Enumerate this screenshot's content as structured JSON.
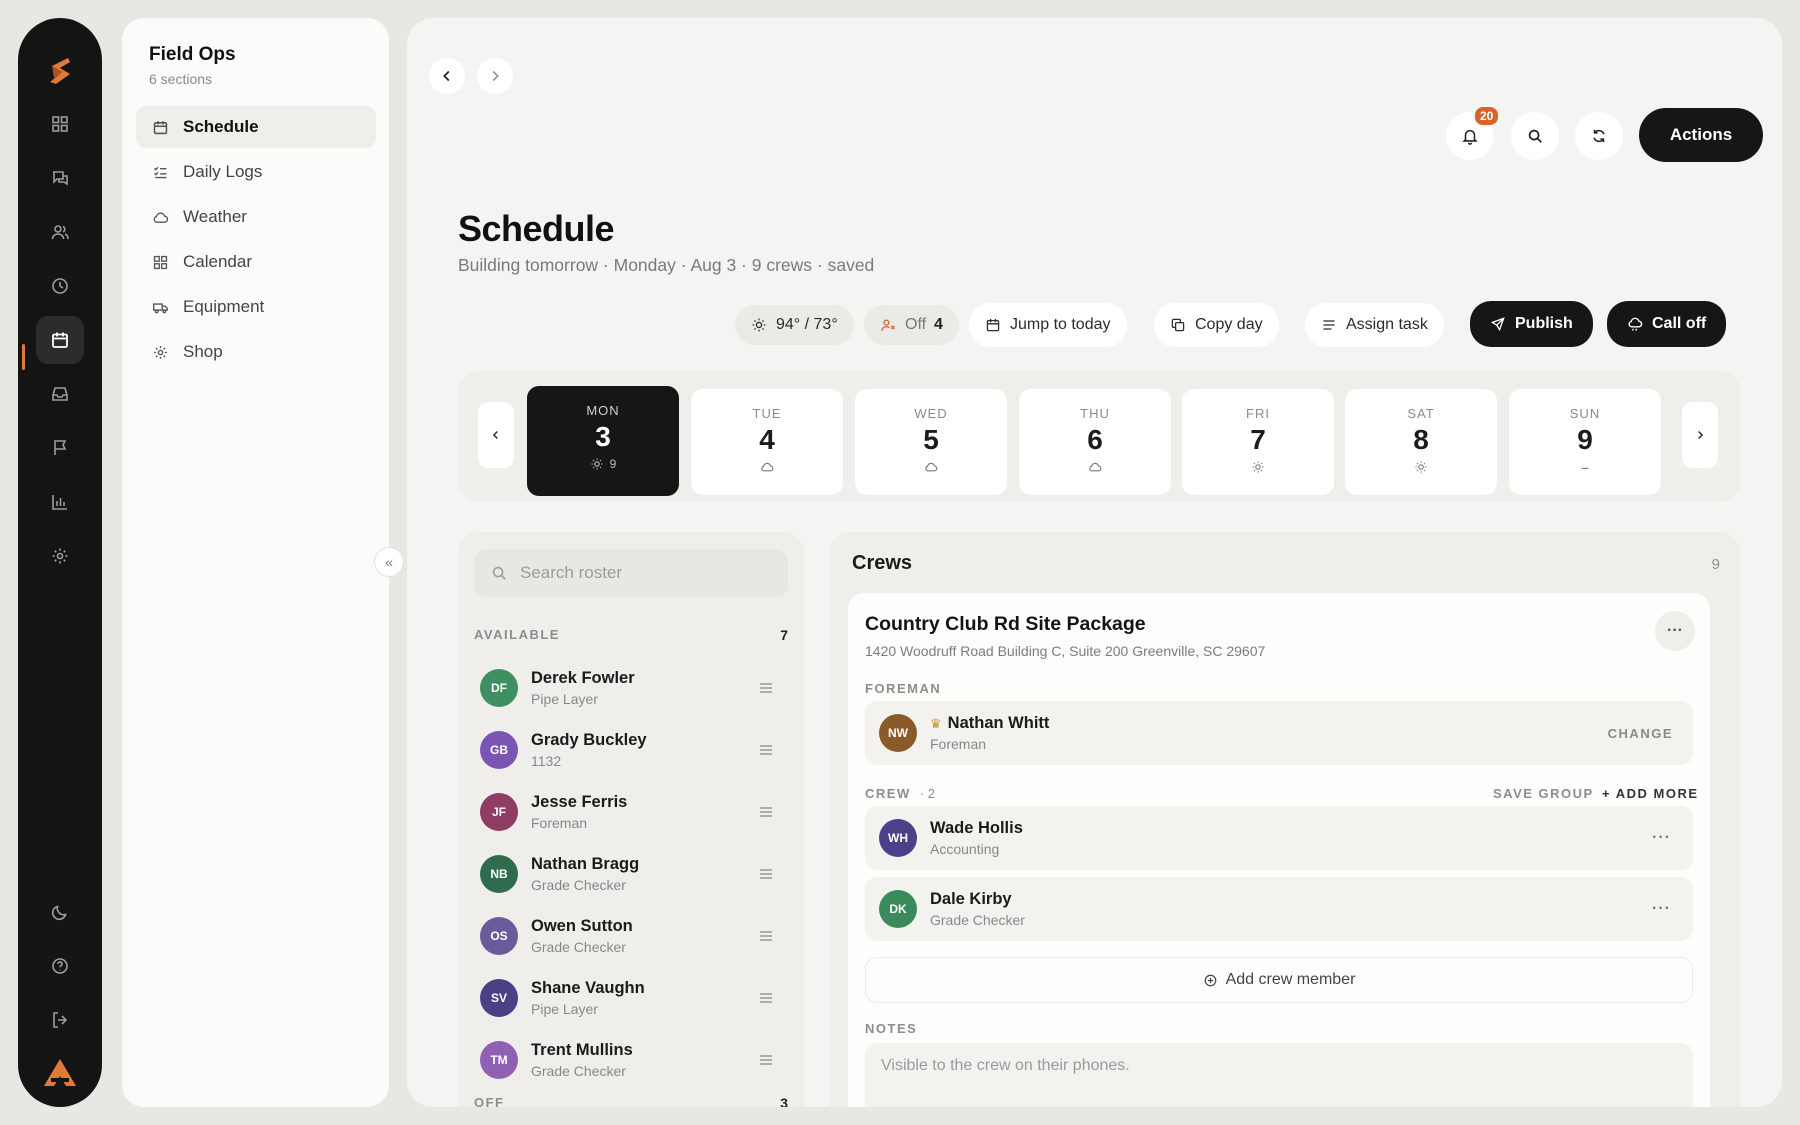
{
  "sub_sidebar": {
    "title": "Field Ops",
    "count": "6 sections",
    "items": [
      {
        "label": "Schedule",
        "icon": "calendar-icon"
      },
      {
        "label": "Daily Logs",
        "icon": "checklist-icon"
      },
      {
        "label": "Weather",
        "icon": "cloud-icon"
      },
      {
        "label": "Calendar",
        "icon": "grid-icon"
      },
      {
        "label": "Equipment",
        "icon": "truck-icon"
      },
      {
        "label": "Shop",
        "icon": "gear-icon"
      }
    ]
  },
  "header": {
    "notifications_count": "20",
    "actions_label": "Actions",
    "collapse_glyph": "«"
  },
  "page": {
    "title": "Schedule",
    "subtitle": "Building tomorrow · Monday · Aug 3 · 9 crews · saved"
  },
  "toolbar": {
    "weather": "94° / 73°",
    "off_label": "Off",
    "off_count": "4",
    "jump_today": "Jump to today",
    "copy_day": "Copy day",
    "assign_task": "Assign task",
    "publish": "Publish",
    "call_off": "Call off"
  },
  "days": [
    {
      "name": "MON",
      "date": "3",
      "weather": "sun",
      "count": "9",
      "active": true
    },
    {
      "name": "TUE",
      "date": "4",
      "weather": "cloud",
      "count": ""
    },
    {
      "name": "WED",
      "date": "5",
      "weather": "cloud",
      "count": ""
    },
    {
      "name": "THU",
      "date": "6",
      "weather": "cloud",
      "count": ""
    },
    {
      "name": "FRI",
      "date": "7",
      "weather": "sun",
      "count": ""
    },
    {
      "name": "SAT",
      "date": "8",
      "weather": "sun",
      "count": ""
    },
    {
      "name": "SUN",
      "date": "9",
      "weather": "dash",
      "count": ""
    }
  ],
  "roster": {
    "search_placeholder": "Search roster",
    "available_label": "AVAILABLE",
    "available_count": "7",
    "off_label": "OFF",
    "off_count": "3",
    "people": [
      {
        "initials": "DF",
        "name": "Derek Fowler",
        "role": "Pipe Layer",
        "color": "#3f8f62"
      },
      {
        "initials": "GB",
        "name": "Grady Buckley",
        "role": "1132",
        "color": "#7b55b3"
      },
      {
        "initials": "JF",
        "name": "Jesse Ferris",
        "role": "Foreman",
        "color": "#8f3b63"
      },
      {
        "initials": "NB",
        "name": "Nathan Bragg",
        "role": "Grade Checker",
        "color": "#2f6c4d"
      },
      {
        "initials": "OS",
        "name": "Owen Sutton",
        "role": "Grade Checker",
        "color": "#6a5a9c"
      },
      {
        "initials": "SV",
        "name": "Shane Vaughn",
        "role": "Pipe Layer",
        "color": "#4b3f86"
      },
      {
        "initials": "TM",
        "name": "Trent Mullins",
        "role": "Grade Checker",
        "color": "#9060b5"
      }
    ]
  },
  "crews": {
    "title": "Crews",
    "count": "9",
    "card": {
      "job_title": "Country Club Rd Site Package",
      "address": "1420 Woodruff Road Building C, Suite 200 Greenville, SC 29607",
      "foreman_label": "FOREMAN",
      "foreman": {
        "initials": "NW",
        "name": "Nathan Whitt",
        "role": "Foreman",
        "color": "#8a5a2b"
      },
      "change_label": "CHANGE",
      "crew_label": "CREW",
      "crew_count": "· 2",
      "save_group": "SAVE GROUP",
      "add_more": "+ ADD MORE",
      "members": [
        {
          "initials": "WH",
          "name": "Wade Hollis",
          "role": "Accounting",
          "color": "#4d3f8a"
        },
        {
          "initials": "DK",
          "name": "Dale Kirby",
          "role": "Grade Checker",
          "color": "#3a8a5b"
        }
      ],
      "add_member": "Add crew member",
      "notes_label": "NOTES",
      "notes_placeholder": "Visible to the crew on their phones."
    }
  }
}
